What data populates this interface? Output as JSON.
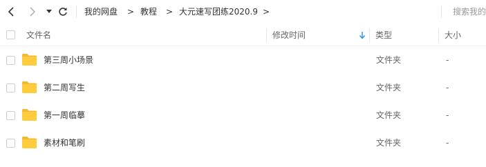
{
  "breadcrumb": {
    "items": [
      "我的网盘",
      "教程",
      "大元速写团练2020.9"
    ],
    "separator": ">",
    "trailing_separator": ">"
  },
  "search": {
    "placeholder": "搜索我的"
  },
  "table": {
    "columns": {
      "name": "文件名",
      "modified": "修改时间",
      "type": "类型",
      "size": "大小"
    },
    "sort": {
      "column": "modified",
      "direction": "descending",
      "icon": "arrow-down-icon"
    },
    "rows": [
      {
        "name": "第三周小场景",
        "modified": "",
        "type": "文件夹",
        "size": "-"
      },
      {
        "name": "第二周写生",
        "modified": "",
        "type": "文件夹",
        "size": "-"
      },
      {
        "name": "第一周临摹",
        "modified": "",
        "type": "文件夹",
        "size": "-"
      },
      {
        "name": "素材和笔刷",
        "modified": "",
        "type": "文件夹",
        "size": "-"
      }
    ]
  },
  "colors": {
    "accent": "#2a8ef5",
    "folder": "#ffcc3d",
    "folder_back": "#f5b82e",
    "text": "#333333",
    "muted": "#666666"
  },
  "icons": [
    "back-arrow-icon",
    "forward-arrow-icon",
    "dropdown-caret-icon",
    "refresh-icon",
    "folder-icon",
    "arrow-down-icon"
  ]
}
